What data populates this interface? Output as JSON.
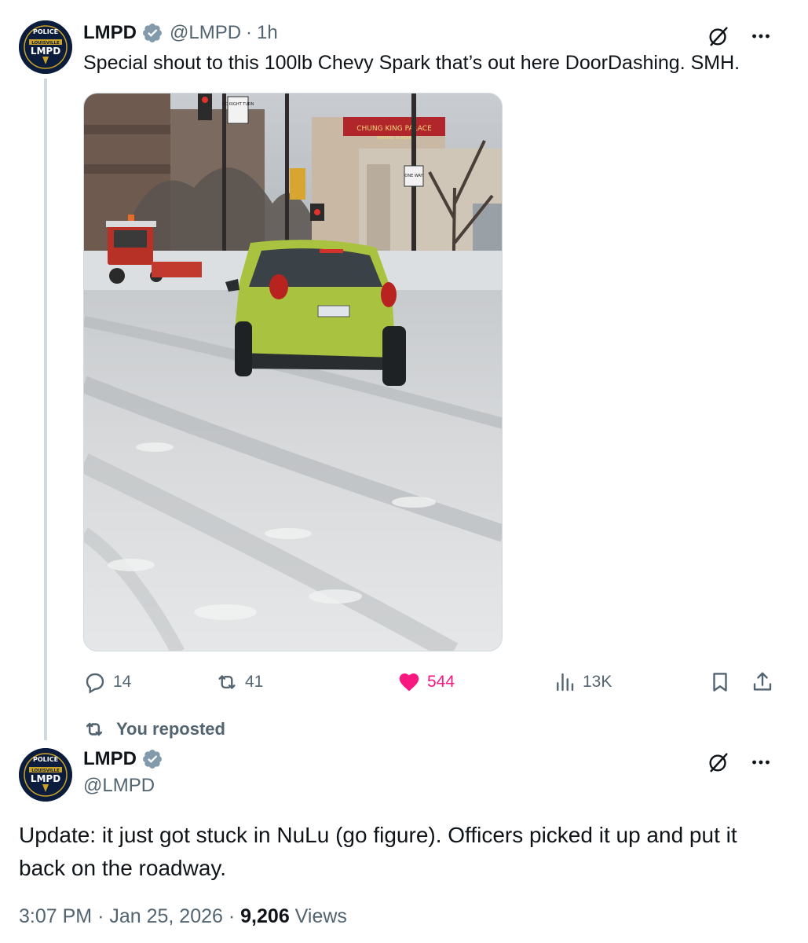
{
  "tweet1": {
    "name": "LMPD",
    "handle": "@LMPD",
    "separator": "·",
    "time": "1h",
    "text": "Special shout to this 100lb Chevy Spark that’s out here DoorDashing. SMH.",
    "avatar_text": {
      "top": "POLICE",
      "middle": "LOUISVILLE",
      "main": "LMPD"
    },
    "media": {
      "sign_no_right_turn": "NO RIGHT TURN",
      "sign_one_way": "ONE WAY",
      "banner": "CHUNG KING PALACE",
      "banner_sub": "PARKING IN REAR"
    },
    "actions": {
      "replies": "14",
      "reposts": "41",
      "likes": "544",
      "views": "13K"
    }
  },
  "repost_banner": "You reposted",
  "tweet2": {
    "name": "LMPD",
    "handle": "@LMPD",
    "text": "Update: it just got stuck in NuLu (go figure). Officers picked it up and put it back on the roadway.",
    "avatar_text": {
      "top": "POLICE",
      "middle": "LOUISVILLE",
      "main": "LMPD"
    },
    "meta": {
      "time": "3:07 PM",
      "separator": "·",
      "date": "Jan 25, 2026",
      "views_count": "9,206",
      "views_label": "Views"
    }
  },
  "colors": {
    "verified": "#829aab",
    "like": "#f91880",
    "muted": "#536471",
    "text": "#0f1419",
    "line": "#cfd9de",
    "car": "#a9c23f"
  }
}
